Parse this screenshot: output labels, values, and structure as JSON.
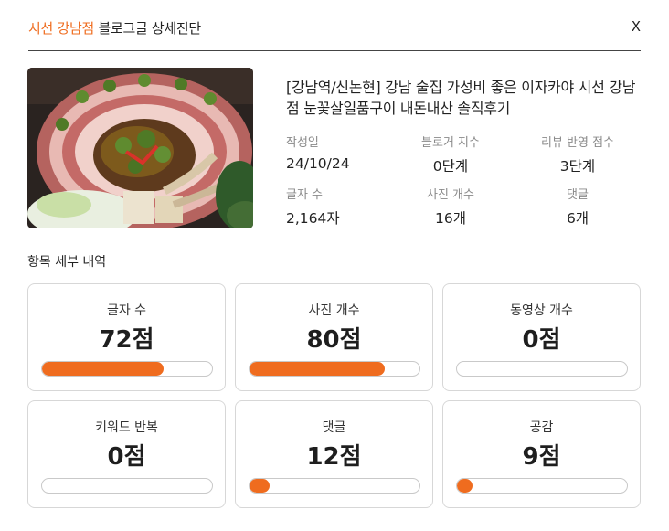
{
  "header": {
    "shop": "시선 강남점",
    "subtitle": "블로그글 상세진단",
    "close_label": "X"
  },
  "post": {
    "title": "[강남역/신논현] 강남 술집 가성비 좋은 이자카야 시선 강남점 눈꽃살일품구이 내돈내산 솔직후기",
    "thumbnail_icon": "food-photo"
  },
  "stats": [
    {
      "label": "작성일",
      "value": "24/10/24"
    },
    {
      "label": "블로거 지수",
      "value": "0단계"
    },
    {
      "label": "리뷰 반영 점수",
      "value": "3단계"
    },
    {
      "label": "글자 수",
      "value": "2,164자"
    },
    {
      "label": "사진 개수",
      "value": "16개"
    },
    {
      "label": "댓글",
      "value": "6개"
    }
  ],
  "section_label": "항목 세부 내역",
  "accent_color": "#ef6c1f",
  "cards": [
    {
      "label": "글자 수",
      "score": "72점",
      "progress": 0.72
    },
    {
      "label": "사진 개수",
      "score": "80점",
      "progress": 0.8
    },
    {
      "label": "동영상 개수",
      "score": "0점",
      "progress": 0.0
    },
    {
      "label": "키워드 반복",
      "score": "0점",
      "progress": 0.0
    },
    {
      "label": "댓글",
      "score": "12점",
      "progress": 0.12
    },
    {
      "label": "공감",
      "score": "9점",
      "progress": 0.09
    }
  ]
}
